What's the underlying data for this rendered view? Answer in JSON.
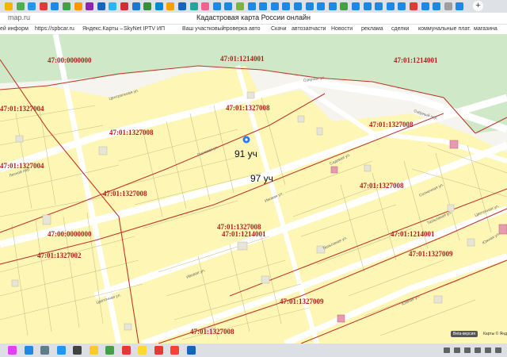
{
  "browser": {
    "url": "map.ru",
    "page_title": "Кадастровая карта России онлайн",
    "tab_colors": [
      "#f4b400",
      "#4caf50",
      "#2196f3",
      "#e53935",
      "#1e88e5",
      "#43a047",
      "#ff9800",
      "#8e24aa",
      "#1565c0",
      "#29b6f6",
      "#d32f2f",
      "#1976d2",
      "#388e3c",
      "#0288d1",
      "#ffa000",
      "#1565c0",
      "#26a69a",
      "#f06292",
      "#1e88e5",
      "#1e88e5",
      "#7cb342",
      "#1e88e5",
      "#1e88e5",
      "#1e88e5",
      "#1e88e5",
      "#1e88e5",
      "#1e88e5",
      "#1e88e5",
      "#1e88e5",
      "#43a047",
      "#1e88e5",
      "#1e88e5",
      "#1e88e5",
      "#1e88e5",
      "#1e88e5",
      "#e53935",
      "#1e88e5",
      "#1e88e5",
      "#9e9e9e",
      "#1e88e5"
    ],
    "new_tab_label": "+",
    "bookmarks": [
      "ей информ",
      "https://spbcar.ru",
      "Яндекс.Карты –",
      "SkyNet IPTV",
      "ИП",
      "Ваш участковый",
      "проверка авто",
      "Скачи",
      "автозапчасти",
      "Новости",
      "реклама",
      "сделки",
      "коммунальные плат.",
      "магазина"
    ]
  },
  "map": {
    "cadastral_labels": [
      "47:01:1214001",
      "47:01:1214001",
      "47:00:0000000",
      "47:01:1327004",
      "47:01:1327008",
      "47:01:1327008",
      "47:01:1327008",
      "47:01:1327004",
      "47:01:1327008",
      "47:01:1327008",
      "47:01:1327008",
      "47:01:1214001",
      "47:01:1214001",
      "47:00:0000000",
      "47:01:1327002",
      "47:01:1327009",
      "47:01:1327009",
      "47:01:1327008"
    ],
    "street_labels": [
      "Центральная ул.",
      "Озерная ул.",
      "Озёрный пер.",
      "Лесной пер.",
      "Цветочная ул.",
      "Цветочная ул.",
      "Полевая ул.",
      "Ивовая ул.",
      "Ивовая ул.",
      "Садовая ул.",
      "Солнечная ул.",
      "Тюльпаная ул.",
      "Тюльпаная ул.",
      "Южная ул.",
      "Южная ул."
    ],
    "plot_labels": [
      "91 уч",
      "97 уч"
    ],
    "marker_color": "#2979ff",
    "beta_label": "Beta-версия",
    "copyright": "Карты © Янд"
  },
  "taskbar": {
    "icon_colors": [
      "#e040fb",
      "#1e88e5",
      "#607d8b",
      "#2196f3",
      "#424242",
      "#ffca28",
      "#43a047",
      "#e53935",
      "#fdd835",
      "#e53935",
      "#f44336",
      "#1565c0"
    ]
  }
}
